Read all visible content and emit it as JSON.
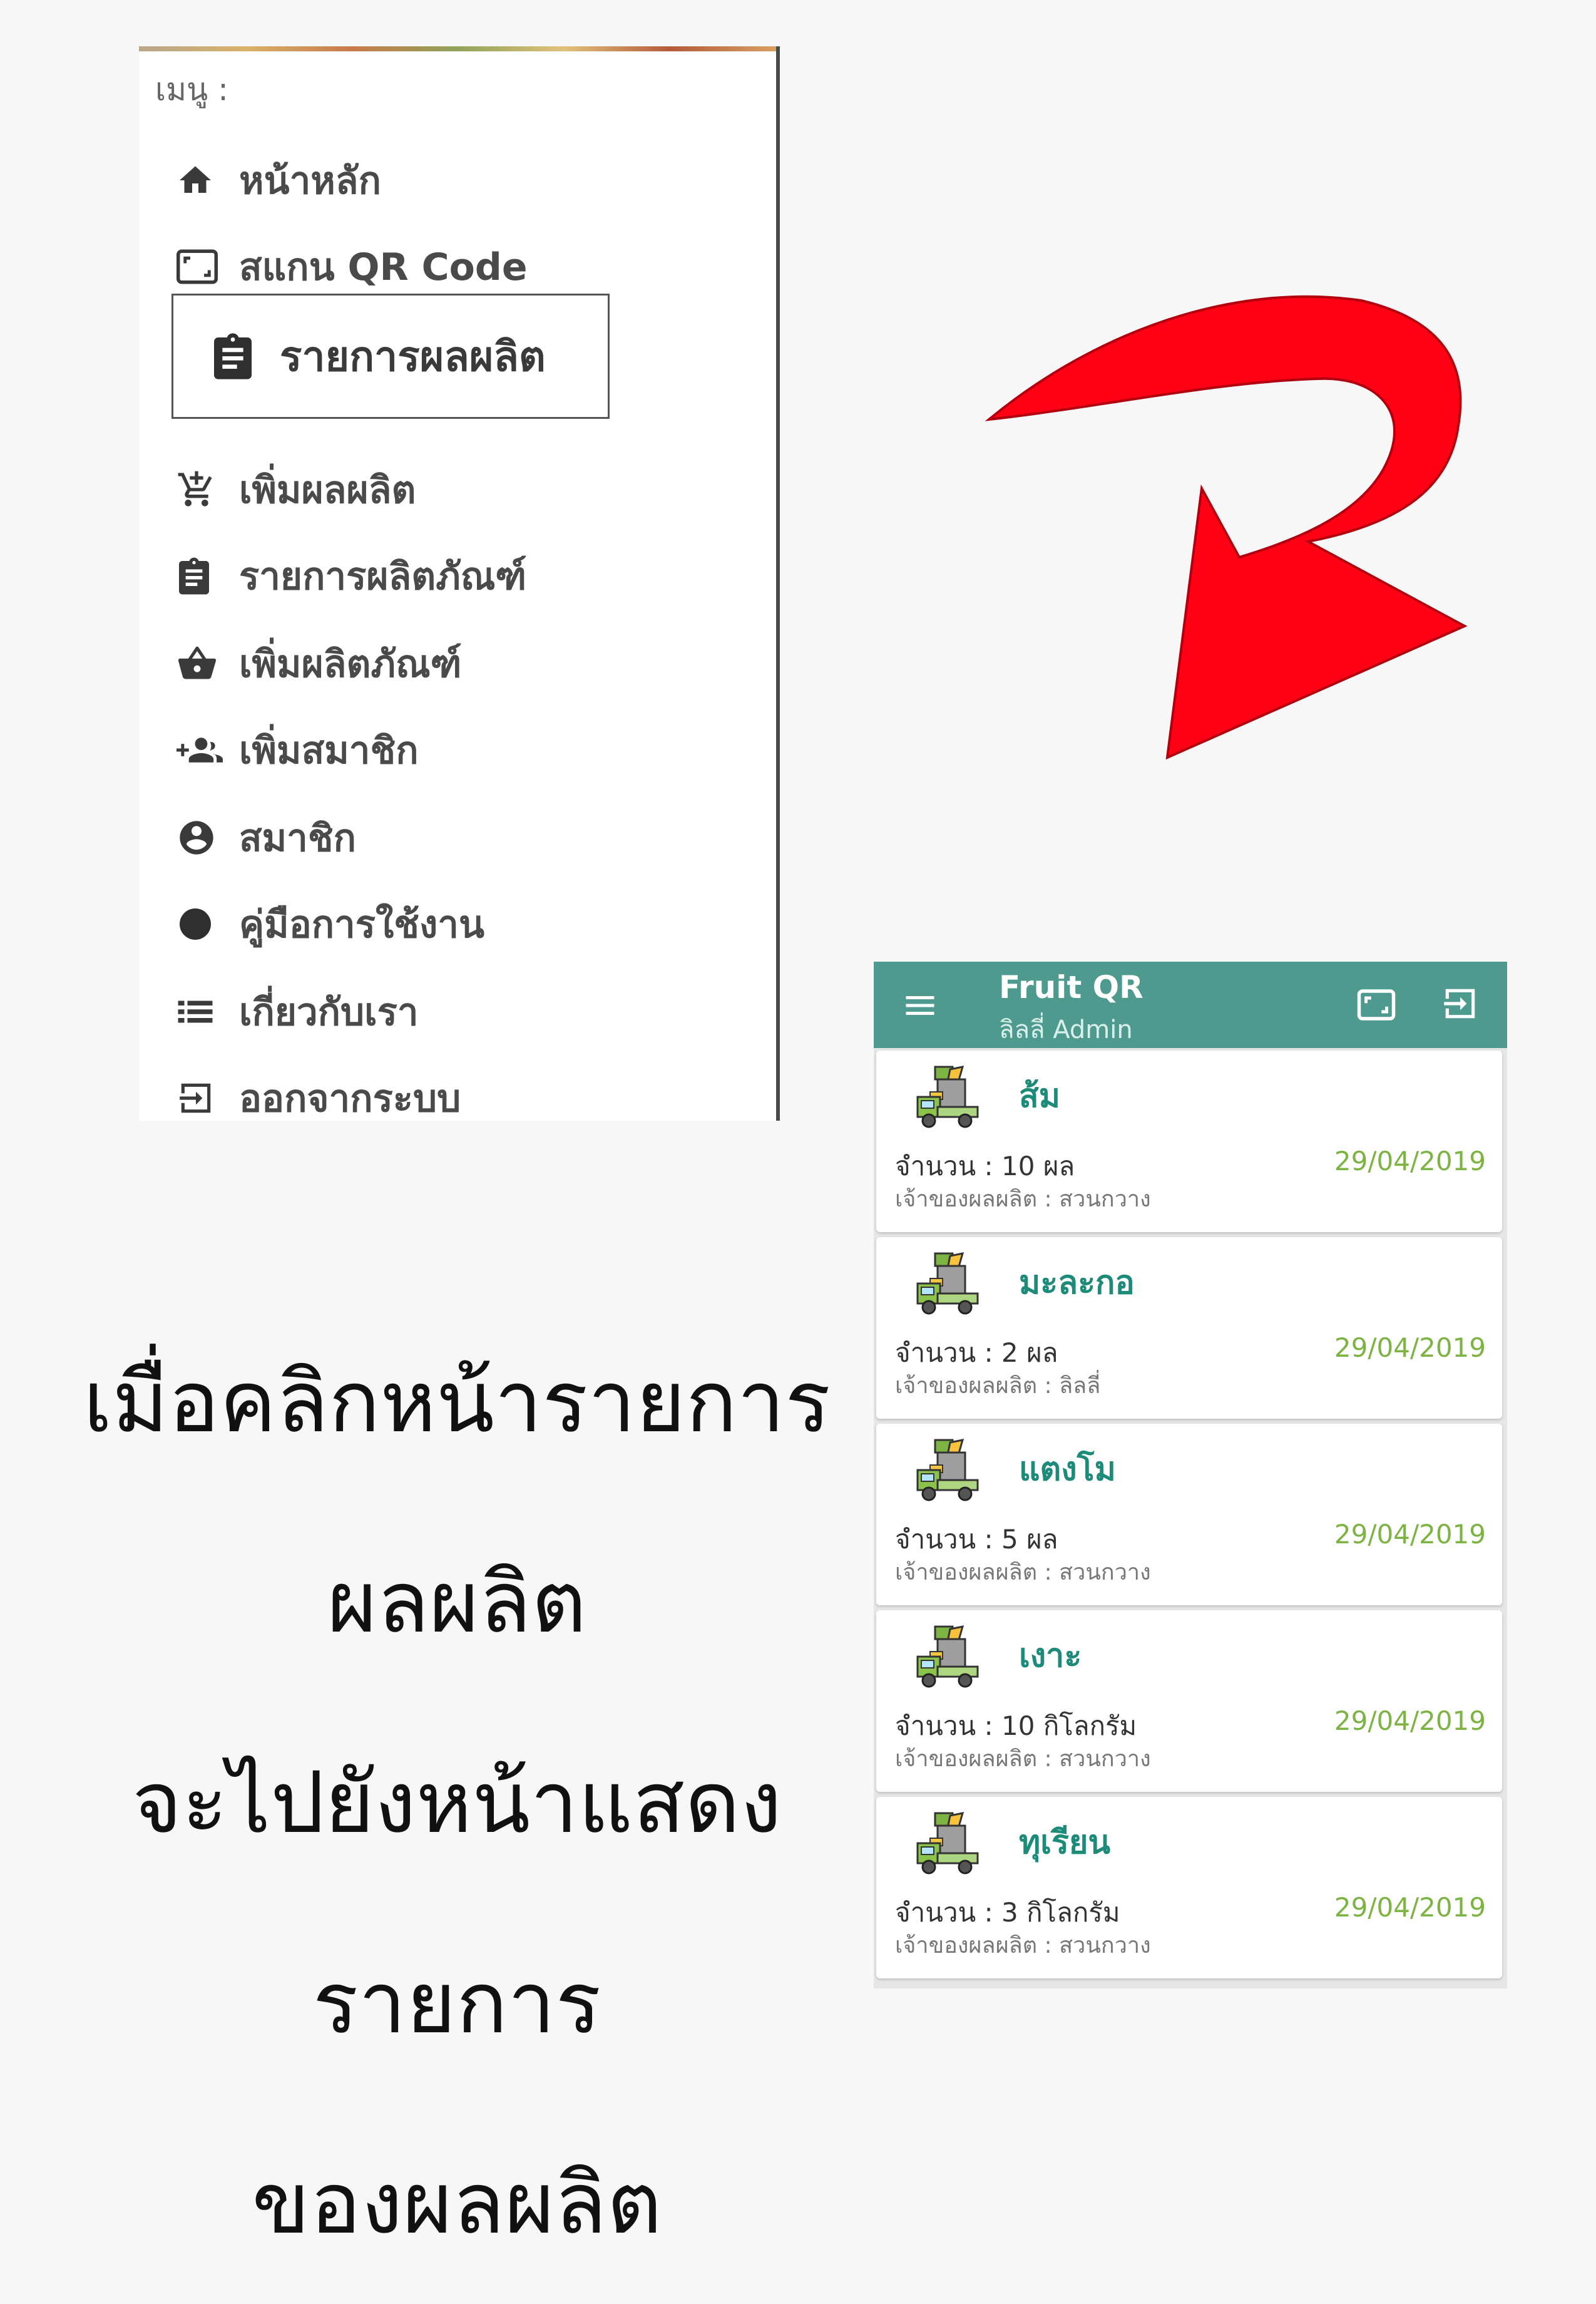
{
  "drawer": {
    "title": "เมนู :",
    "items": [
      {
        "label": "หน้าหลัก",
        "icon": "home-icon"
      },
      {
        "label": "สแกน QR Code",
        "icon": "qr-scan-icon"
      },
      {
        "label": "รายการผลผลิต",
        "icon": "clipboard-icon"
      },
      {
        "label": "เพิ่มผลผลิต",
        "icon": "add-cart-icon"
      },
      {
        "label": "รายการผลิตภัณฑ์",
        "icon": "clipboard-icon"
      },
      {
        "label": "เพิ่มผลิตภัณฑ์",
        "icon": "basket-icon"
      },
      {
        "label": "เพิ่มสมาชิก",
        "icon": "add-people-icon"
      },
      {
        "label": "สมาชิก",
        "icon": "account-circle-icon"
      },
      {
        "label": "คู่มือการใช้งาน",
        "icon": "dot-icon"
      },
      {
        "label": "เกี่ยวกับเรา",
        "icon": "list-icon"
      },
      {
        "label": "ออกจากระบบ",
        "icon": "logout-icon"
      }
    ]
  },
  "caption": {
    "line1": "เมื่อคลิกหน้ารายการผลผลิต",
    "line2": "จะไปยังหน้าแสดงรายการ",
    "line3": "ของผลผลิต"
  },
  "app": {
    "title": "Fruit QR",
    "subtitle": "ลิลลี่ Admin",
    "colors": {
      "appbar": "#4e9a8f",
      "name": "#1d8b79",
      "date": "#7cb342",
      "arrow": "#ff0014"
    },
    "products": [
      {
        "name": "ส้ม",
        "quantity": "จำนวน : 10 ผล",
        "owner": "เจ้าของผลผลิต : สวนกวาง",
        "date": "29/04/2019"
      },
      {
        "name": "มะละกอ",
        "quantity": "จำนวน : 2 ผล",
        "owner": "เจ้าของผลผลิต : ลิลลี่",
        "date": "29/04/2019"
      },
      {
        "name": "แตงโม",
        "quantity": "จำนวน : 5 ผล",
        "owner": "เจ้าของผลผลิต : สวนกวาง",
        "date": "29/04/2019"
      },
      {
        "name": "เงาะ",
        "quantity": "จำนวน : 10 กิโลกรัม",
        "owner": "เจ้าของผลผลิต : สวนกวาง",
        "date": "29/04/2019"
      },
      {
        "name": "ทุเรียน",
        "quantity": "จำนวน : 3 กิโลกรัม",
        "owner": "เจ้าของผลผลิต : สวนกวาง",
        "date": "29/04/2019"
      }
    ]
  }
}
